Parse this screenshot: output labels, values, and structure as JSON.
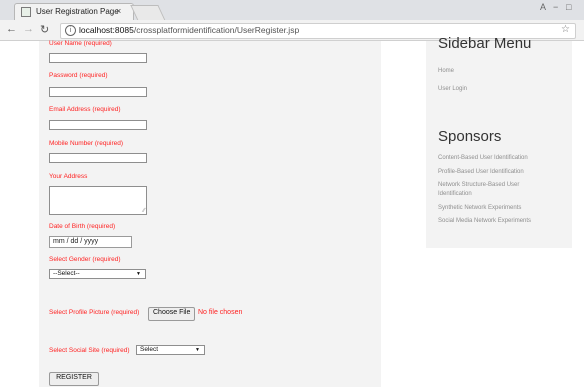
{
  "browser": {
    "tab_title": "User Registration Page",
    "tab_close": "×",
    "url_host": "localhost:8085",
    "url_path": "/crossplatformidentification/UserRegister.jsp",
    "icons": [
      "favicon",
      "back-arrow",
      "forward-arrow",
      "reload-icon",
      "info-icon",
      "star-icon"
    ],
    "window_controls": [
      "A",
      "−",
      "□"
    ]
  },
  "form": {
    "username_label": "User Name (required)",
    "username_value": "",
    "password_label": "Password (required)",
    "password_value": "",
    "email_label": "Email Address (required)",
    "email_value": "",
    "mobile_label": "Mobile Number (required)",
    "mobile_value": "",
    "address_label": "Your Address",
    "address_value": "",
    "dob_label": "Date of Birth (required)",
    "dob_placeholder": "mm / dd / yyyy",
    "gender_label": "Select Gender (required)",
    "gender_selected": "--Select--",
    "picture_label": "Select Profile Picture (required)",
    "choose_file_label": "Choose File",
    "file_status": "No file chosen",
    "social_label": "Select Social Site (required)",
    "social_selected": "Select",
    "submit_label": "REGISTER"
  },
  "sidebar": {
    "menu_title": "Sidebar Menu",
    "menu_items": [
      "Home",
      "User Login"
    ],
    "sponsors_title": "Sponsors",
    "sponsor_items": [
      "Content-Based User Identification",
      "Profile-Based User Identification",
      "Network Structure-Based User",
      "Identification",
      "Synthetic Network Experiments",
      "Social Media Network Experiments"
    ]
  },
  "colors": {
    "label_red": "#ff2222",
    "panel_gray": "#f3f3f3",
    "link_gray": "#8f8f8f"
  }
}
